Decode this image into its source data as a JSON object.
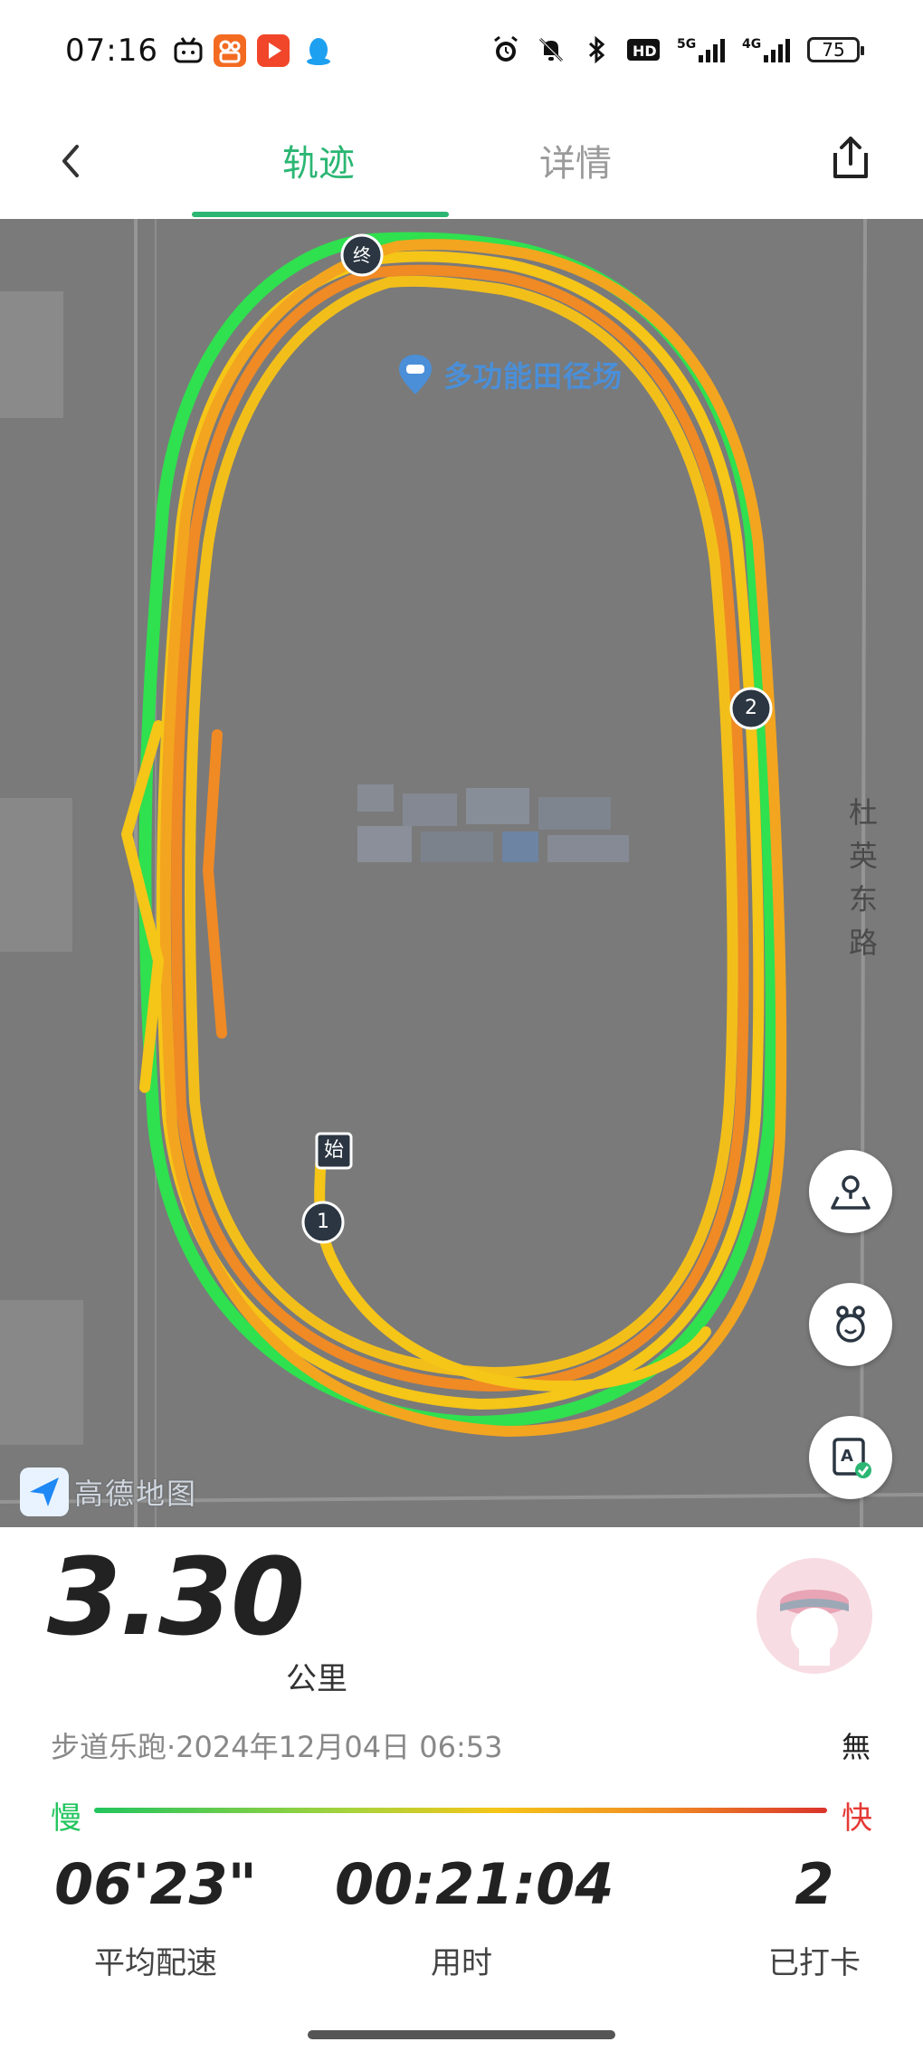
{
  "status_bar": {
    "time": "07:16",
    "network": "5G",
    "network2": "4G",
    "hd": "HD",
    "battery": "75"
  },
  "header": {
    "tabs": [
      {
        "label": "轨迹",
        "active": true
      },
      {
        "label": "详情",
        "active": false
      }
    ],
    "accent_color": "#2bb673"
  },
  "map": {
    "poi_label": "多功能田径场",
    "road_label": "杜英东路",
    "start_marker": "始",
    "end_marker": "终",
    "lap_markers": [
      "1",
      "2"
    ],
    "provider": "高德地图"
  },
  "run": {
    "distance": "3.30",
    "distance_unit": "公里",
    "meta": "步道乐跑·2024年12月04日 06:53",
    "weather": "無",
    "pace_slow_label": "慢",
    "pace_fast_label": "快",
    "stats": [
      {
        "value": "06'23\"",
        "label": "平均配速"
      },
      {
        "value": "00:21:04",
        "label": "用时"
      },
      {
        "value": "2",
        "label": "已打卡"
      }
    ]
  }
}
